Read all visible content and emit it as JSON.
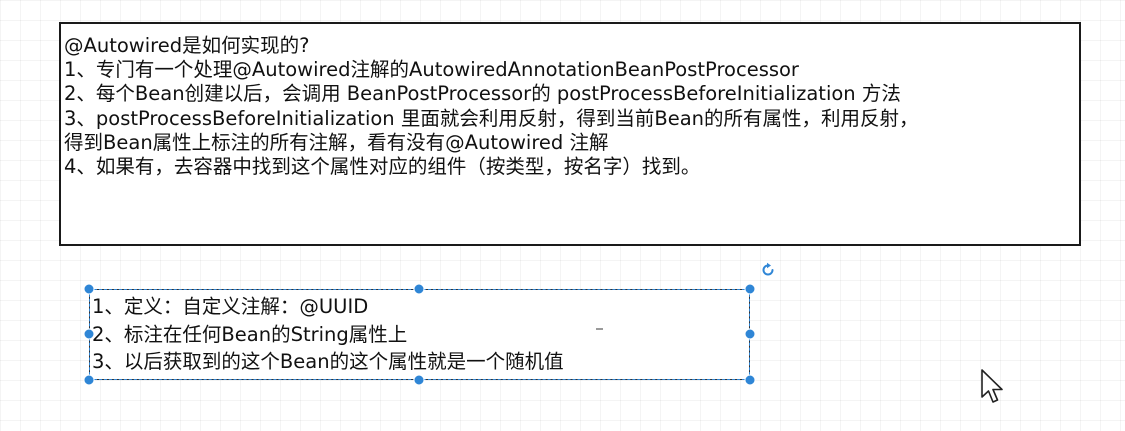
{
  "main_box": {
    "lines": [
      "@Autowired是如何实现的?",
      "1、专门有一个处理@Autowired注解的AutowiredAnnotationBeanPostProcessor",
      "2、每个Bean创建以后，会调用 BeanPostProcessor的 postProcessBeforeInitialization 方法",
      "3、postProcessBeforeInitialization 里面就会利用反射，得到当前Bean的所有属性，利用反射，",
      "得到Bean属性上标注的所有注解，看有没有@Autowired 注解",
      "4、如果有，去容器中找到这个属性对应的组件（按类型，按名字）找到。"
    ]
  },
  "uuid_box": {
    "lines": [
      "1、定义：自定义注解：@UUID",
      "2、标注在任何Bean的String属性上",
      "3、以后获取到的这个Bean的这个属性就是一个随机值"
    ]
  },
  "colors": {
    "selection": "#2f86d6",
    "border": "#1a1a1a",
    "text": "#111111"
  },
  "icons": {
    "rotate": "rotate-icon",
    "cursor": "mouse-pointer-icon"
  }
}
